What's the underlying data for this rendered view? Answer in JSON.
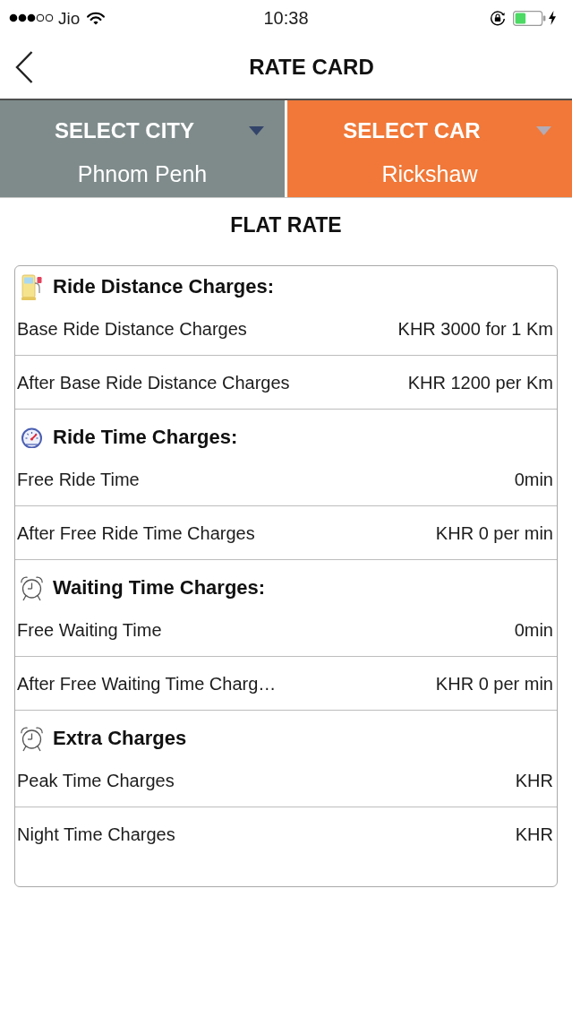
{
  "status_bar": {
    "carrier": "Jio",
    "time": "10:38"
  },
  "nav": {
    "title": "RATE CARD"
  },
  "selectors": [
    {
      "label": "SELECT CITY",
      "value": "Phnom Penh",
      "selected": false
    },
    {
      "label": "SELECT CAR",
      "value": "Rickshaw",
      "selected": true
    }
  ],
  "rate_type": "FLAT RATE",
  "sections": [
    {
      "kind": "distance",
      "title": "Ride Distance Charges:",
      "rows": [
        {
          "label": "Base Ride Distance Charges",
          "value": "KHR 3000 for 1 Km"
        },
        {
          "label": "After Base Ride Distance Charges",
          "value": "KHR 1200 per Km"
        }
      ]
    },
    {
      "kind": "time",
      "title": "Ride Time Charges:",
      "rows": [
        {
          "label": "Free Ride Time",
          "value": "0min"
        },
        {
          "label": "After Free Ride Time Charges",
          "value": "KHR 0 per min"
        }
      ]
    },
    {
      "kind": "waiting",
      "title": "Waiting Time Charges:",
      "rows": [
        {
          "label": "Free Waiting Time",
          "value": "0min"
        },
        {
          "label": "After Free Waiting Time Charg…",
          "value": "KHR 0 per min"
        }
      ]
    },
    {
      "kind": "extra",
      "title": "Extra Charges",
      "rows": [
        {
          "label": "Peak Time Charges",
          "value": "KHR"
        },
        {
          "label": "Night Time Charges",
          "value": "KHR"
        }
      ]
    }
  ]
}
